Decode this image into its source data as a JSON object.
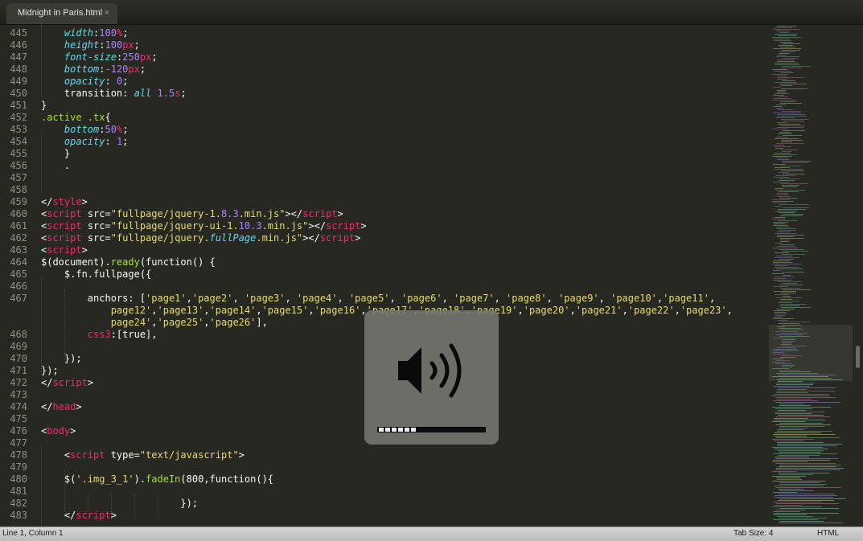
{
  "tab": {
    "title": "Midnight in Paris.html",
    "close_glyph": "×"
  },
  "gutter": {
    "line_numbers": [
      "445",
      "446",
      "447",
      "448",
      "449",
      "450",
      "451",
      "452",
      "453",
      "454",
      "455",
      "456",
      "457",
      "458",
      "459",
      "460",
      "461",
      "462",
      "463",
      "464",
      "465",
      "466",
      "467",
      "",
      "",
      "468",
      "469",
      "470",
      "471",
      "472",
      "473",
      "474",
      "475",
      "476",
      "477",
      "478",
      "479",
      "480",
      "481",
      "482",
      "483"
    ]
  },
  "code": {
    "lines": [
      [
        {
          "t": "    "
        },
        {
          "t": "width",
          "c": "p"
        },
        {
          "t": ":"
        },
        {
          "t": "100",
          "c": "n"
        },
        {
          "t": "%",
          "c": "k"
        },
        {
          "t": ";"
        }
      ],
      [
        {
          "t": "    "
        },
        {
          "t": "height",
          "c": "p"
        },
        {
          "t": ":"
        },
        {
          "t": "100",
          "c": "n"
        },
        {
          "t": "px",
          "c": "k"
        },
        {
          "t": ";"
        }
      ],
      [
        {
          "t": "    "
        },
        {
          "t": "font-size",
          "c": "p"
        },
        {
          "t": ":"
        },
        {
          "t": "250",
          "c": "n"
        },
        {
          "t": "px",
          "c": "k"
        },
        {
          "t": ";"
        }
      ],
      [
        {
          "t": "    "
        },
        {
          "t": "bottom",
          "c": "p"
        },
        {
          "t": ":"
        },
        {
          "t": "-120",
          "c": "n"
        },
        {
          "t": "px",
          "c": "k"
        },
        {
          "t": ";"
        }
      ],
      [
        {
          "t": "    "
        },
        {
          "t": "opacity",
          "c": "p"
        },
        {
          "t": ": "
        },
        {
          "t": "0",
          "c": "n"
        },
        {
          "t": ";"
        }
      ],
      [
        {
          "t": "    transition: "
        },
        {
          "t": "all",
          "c": "p"
        },
        {
          "t": " "
        },
        {
          "t": "1.5",
          "c": "n"
        },
        {
          "t": "s",
          "c": "k"
        },
        {
          "t": ";"
        }
      ],
      [
        {
          "t": "}"
        }
      ],
      [
        {
          "t": ".active .tx",
          "c": "f"
        },
        {
          "t": "{"
        }
      ],
      [
        {
          "t": "    "
        },
        {
          "t": "bottom",
          "c": "p"
        },
        {
          "t": ":"
        },
        {
          "t": "50",
          "c": "n"
        },
        {
          "t": "%",
          "c": "k"
        },
        {
          "t": ";"
        }
      ],
      [
        {
          "t": "    "
        },
        {
          "t": "opacity",
          "c": "p"
        },
        {
          "t": ": "
        },
        {
          "t": "1",
          "c": "n"
        },
        {
          "t": ";"
        }
      ],
      [
        {
          "t": "    }"
        }
      ],
      [
        {
          "t": "    ."
        }
      ],
      [],
      [],
      [
        {
          "t": "</"
        },
        {
          "t": "style",
          "c": "k"
        },
        {
          "t": ">"
        }
      ],
      [
        {
          "t": "<"
        },
        {
          "t": "script",
          "c": "k"
        },
        {
          "t": " src="
        },
        {
          "t": "\"fullpage/jquery-1.",
          "c": "s"
        },
        {
          "t": "8.3",
          "c": "n"
        },
        {
          "t": ".min.js\"",
          "c": "s"
        },
        {
          "t": "></"
        },
        {
          "t": "script",
          "c": "k"
        },
        {
          "t": ">"
        }
      ],
      [
        {
          "t": "<"
        },
        {
          "t": "script",
          "c": "k"
        },
        {
          "t": " src="
        },
        {
          "t": "\"fullpage/jquery-ui-1.",
          "c": "s"
        },
        {
          "t": "10.3",
          "c": "n"
        },
        {
          "t": ".min.js\"",
          "c": "s"
        },
        {
          "t": "></"
        },
        {
          "t": "script",
          "c": "k"
        },
        {
          "t": ">"
        }
      ],
      [
        {
          "t": "<"
        },
        {
          "t": "script",
          "c": "k"
        },
        {
          "t": " src="
        },
        {
          "t": "\"fullpage/jquery.",
          "c": "s"
        },
        {
          "t": "fullPage",
          "c": "p"
        },
        {
          "t": ".min.js\"",
          "c": "s"
        },
        {
          "t": "></"
        },
        {
          "t": "script",
          "c": "k"
        },
        {
          "t": ">"
        }
      ],
      [
        {
          "t": "<"
        },
        {
          "t": "script",
          "c": "k"
        },
        {
          "t": ">"
        }
      ],
      [
        {
          "t": "$(document)."
        },
        {
          "t": "ready",
          "c": "f"
        },
        {
          "t": "(function() {"
        }
      ],
      [
        {
          "t": "    $.fn.fullpage({"
        }
      ],
      [],
      [
        {
          "t": "        anchors: ["
        },
        {
          "t": "'page1'",
          "c": "s"
        },
        {
          "t": ","
        },
        {
          "t": "'page2'",
          "c": "s"
        },
        {
          "t": ", "
        },
        {
          "t": "'page3'",
          "c": "s"
        },
        {
          "t": ", "
        },
        {
          "t": "'page4'",
          "c": "s"
        },
        {
          "t": ", "
        },
        {
          "t": "'page5'",
          "c": "s"
        },
        {
          "t": ", "
        },
        {
          "t": "'page6'",
          "c": "s"
        },
        {
          "t": ", "
        },
        {
          "t": "'page7'",
          "c": "s"
        },
        {
          "t": ", "
        },
        {
          "t": "'page8'",
          "c": "s"
        },
        {
          "t": ", "
        },
        {
          "t": "'page9'",
          "c": "s"
        },
        {
          "t": ", "
        },
        {
          "t": "'page10'",
          "c": "s"
        },
        {
          "t": ","
        },
        {
          "t": "'page11'",
          "c": "s"
        },
        {
          "t": ","
        }
      ],
      [
        {
          "t": "            "
        },
        {
          "t": "page12'",
          "c": "s"
        },
        {
          "t": ","
        },
        {
          "t": "'page13'",
          "c": "s"
        },
        {
          "t": ","
        },
        {
          "t": "'page14'",
          "c": "s"
        },
        {
          "t": ","
        },
        {
          "t": "'page15'",
          "c": "s"
        },
        {
          "t": ","
        },
        {
          "t": "'page16'",
          "c": "s"
        },
        {
          "t": ","
        },
        {
          "t": "'page17'",
          "c": "s"
        },
        {
          "t": ","
        },
        {
          "t": "'page18'",
          "c": "s"
        },
        {
          "t": ","
        },
        {
          "t": "'page19'",
          "c": "s"
        },
        {
          "t": ","
        },
        {
          "t": "'page20'",
          "c": "s"
        },
        {
          "t": ","
        },
        {
          "t": "'page21'",
          "c": "s"
        },
        {
          "t": ","
        },
        {
          "t": "'page22'",
          "c": "s"
        },
        {
          "t": ","
        },
        {
          "t": "'page23'",
          "c": "s"
        },
        {
          "t": ","
        }
      ],
      [
        {
          "t": "            "
        },
        {
          "t": "page24'",
          "c": "s"
        },
        {
          "t": ","
        },
        {
          "t": "'page25'",
          "c": "s"
        },
        {
          "t": ","
        },
        {
          "t": "'page26'",
          "c": "s"
        },
        {
          "t": "],"
        }
      ],
      [
        {
          "t": "        "
        },
        {
          "t": "css3",
          "c": "k"
        },
        {
          "t": ":[true],"
        }
      ],
      [],
      [
        {
          "t": "    });"
        }
      ],
      [
        {
          "t": "});"
        }
      ],
      [
        {
          "t": "</"
        },
        {
          "t": "script",
          "c": "k"
        },
        {
          "t": ">"
        }
      ],
      [],
      [
        {
          "t": "</"
        },
        {
          "t": "head",
          "c": "k"
        },
        {
          "t": ">"
        }
      ],
      [],
      [
        {
          "t": "<"
        },
        {
          "t": "body",
          "c": "k"
        },
        {
          "t": ">"
        }
      ],
      [],
      [
        {
          "t": "    <"
        },
        {
          "t": "script",
          "c": "k"
        },
        {
          "t": " type="
        },
        {
          "t": "\"text/javascript\"",
          "c": "s"
        },
        {
          "t": ">"
        }
      ],
      [],
      [
        {
          "t": "    $("
        },
        {
          "t": "'.img_3_1'",
          "c": "s"
        },
        {
          "t": ")."
        },
        {
          "t": "fadeIn",
          "c": "f"
        },
        {
          "t": "(800,function(){"
        }
      ],
      [],
      [
        {
          "t": "                        });"
        }
      ],
      [
        {
          "t": "    </"
        },
        {
          "t": "script",
          "c": "k"
        },
        {
          "t": ">"
        }
      ]
    ]
  },
  "hud": {
    "kind": "volume",
    "icon": "speaker-volume-icon",
    "segments_total": 16,
    "volume_fraction": 0.375
  },
  "status": {
    "position": "Line 1, Column 1",
    "tab_size": "Tab Size: 4",
    "syntax": "HTML"
  },
  "colors": {
    "background": "#272822",
    "keyword": "#f92672",
    "string": "#e6db74",
    "number": "#ae81ff",
    "property": "#66d9ef",
    "function": "#a6e22e"
  }
}
